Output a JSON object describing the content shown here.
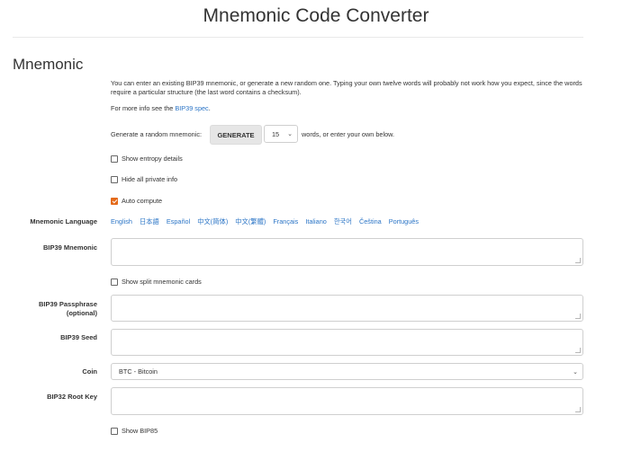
{
  "page": {
    "title": "Mnemonic Code Converter"
  },
  "mnemonic": {
    "heading": "Mnemonic",
    "intro": "You can enter an existing BIP39 mnemonic, or generate a new random one. Typing your own twelve words will probably not work how you expect, since the words require a particular structure (the last word contains a checksum).",
    "more_info_prefix": "For more info see the",
    "more_info_link": "BIP39 spec",
    "more_info_suffix": ".",
    "generate_prefix": "Generate a random mnemonic:",
    "generate_button": "GENERATE",
    "word_count": "15",
    "generate_suffix": "words, or enter your own below.",
    "show_entropy": {
      "label": "Show entropy details",
      "checked": false
    },
    "hide_private": {
      "label": "Hide all private info",
      "checked": false
    },
    "auto_compute": {
      "label": "Auto compute",
      "checked": true
    }
  },
  "language": {
    "label": "Mnemonic Language",
    "options": [
      "English",
      "日本語",
      "Español",
      "中文(简体)",
      "中文(繁體)",
      "Français",
      "Italiano",
      "한국어",
      "Čeština",
      "Português"
    ]
  },
  "fields": {
    "bip39_mnemonic_label": "BIP39 Mnemonic",
    "bip39_mnemonic_value": "",
    "split_cards": {
      "label": "Show split mnemonic cards",
      "checked": false
    },
    "passphrase_label_1": "BIP39 Passphrase",
    "passphrase_label_2": "(optional)",
    "passphrase_value": "",
    "seed_label": "BIP39 Seed",
    "seed_value": "",
    "coin_label": "Coin",
    "coin_value": "BTC - Bitcoin",
    "root_key_label": "BIP32 Root Key",
    "root_key_value": "",
    "show_bip85": {
      "label": "Show BIP85",
      "checked": false
    }
  },
  "colors": {
    "accent": "#e46a1a",
    "link": "#2a74c6"
  }
}
